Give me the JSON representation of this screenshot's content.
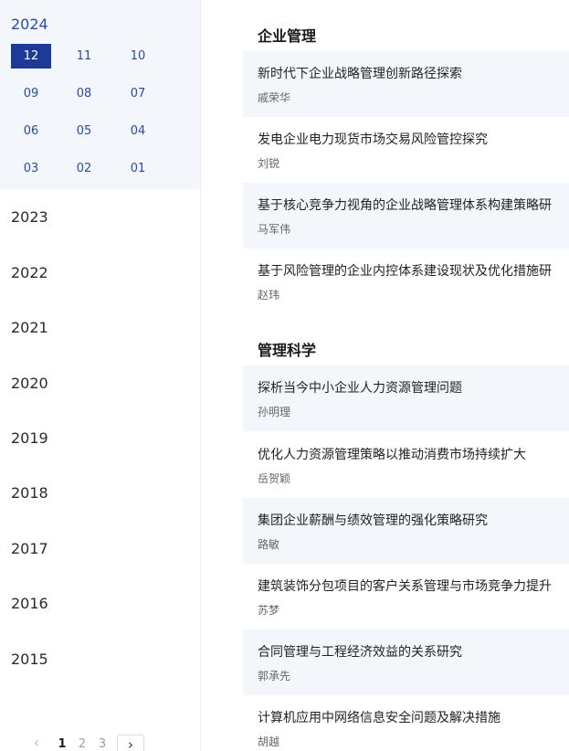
{
  "sidebar": {
    "active_year": "2024",
    "months": [
      "12",
      "11",
      "10",
      "09",
      "08",
      "07",
      "06",
      "05",
      "04",
      "03",
      "02",
      "01"
    ],
    "active_month": "12",
    "years": [
      "2023",
      "2022",
      "2021",
      "2020",
      "2019",
      "2018",
      "2017",
      "2016",
      "2015"
    ],
    "pagination": {
      "prev": "‹",
      "pages": [
        "1",
        "2",
        "3"
      ],
      "current": "1",
      "next": "›"
    }
  },
  "sections": [
    {
      "title": "企业管理",
      "articles": [
        {
          "title": "新时代下企业战略管理创新路径探索",
          "author": "戚荣华"
        },
        {
          "title": "发电企业电力现货市场交易风险管控探究",
          "author": "刘锐"
        },
        {
          "title": "基于核心竞争力视角的企业战略管理体系构建策略研",
          "author": "马军伟"
        },
        {
          "title": "基于风险管理的企业内控体系建设现状及优化措施研",
          "author": "赵玮"
        }
      ]
    },
    {
      "title": "管理科学",
      "articles": [
        {
          "title": "探析当今中小企业人力资源管理问题",
          "author": "孙明理"
        },
        {
          "title": "优化人力资源管理策略以推动消费市场持续扩大",
          "author": "岳贺颖"
        },
        {
          "title": "集团企业薪酬与绩效管理的强化策略研究",
          "author": "路敏"
        },
        {
          "title": "建筑装饰分包项目的客户关系管理与市场竞争力提升",
          "author": "苏梦"
        },
        {
          "title": "合同管理与工程经济效益的关系研究",
          "author": "郭承先"
        },
        {
          "title": "计算机应用中网络信息安全问题及解决措施",
          "author": "胡越"
        }
      ]
    }
  ]
}
